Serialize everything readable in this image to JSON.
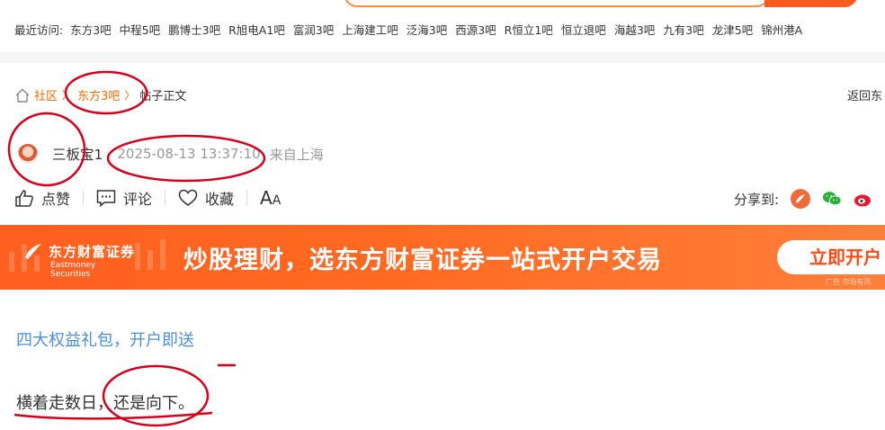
{
  "recent": {
    "label": "最近访问:",
    "items": [
      "东方3吧",
      "中程5吧",
      "鹏博士3吧",
      "R旭电A1吧",
      "富润3吧",
      "上海建工吧",
      "泛海3吧",
      "西源3吧",
      "R恒立1吧",
      "恒立退吧",
      "海越3吧",
      "九有3吧",
      "龙津5吧",
      "锦州港A"
    ]
  },
  "breadcrumb": {
    "community": "社区",
    "forum": "东方3吧",
    "current": "帖子正文",
    "back": "返回东"
  },
  "post": {
    "author": "三板宝1",
    "time": "2025-08-13 13:37:10",
    "location": "来自上海"
  },
  "actions": {
    "like": "点赞",
    "comment": "评论",
    "favorite": "收藏",
    "font_big": "A",
    "font_small": "A",
    "share_label": "分享到:"
  },
  "banner": {
    "brand_cn": "东方财富证券",
    "brand_en": "Eastmoney Securities",
    "slogan": "炒股理财，选东方财富证券一站式开户交易",
    "cta": "立即开户",
    "ad_tag": "广告 市场有风"
  },
  "content": {
    "promo_link": "四大权益礼包，开户即送",
    "text": "横着走数日，还是向下。"
  },
  "colors": {
    "accent": "#ff6a00",
    "banner": "#ff5f1f",
    "link_blue": "#4a90d9",
    "annotation_red": "#d9001b"
  }
}
